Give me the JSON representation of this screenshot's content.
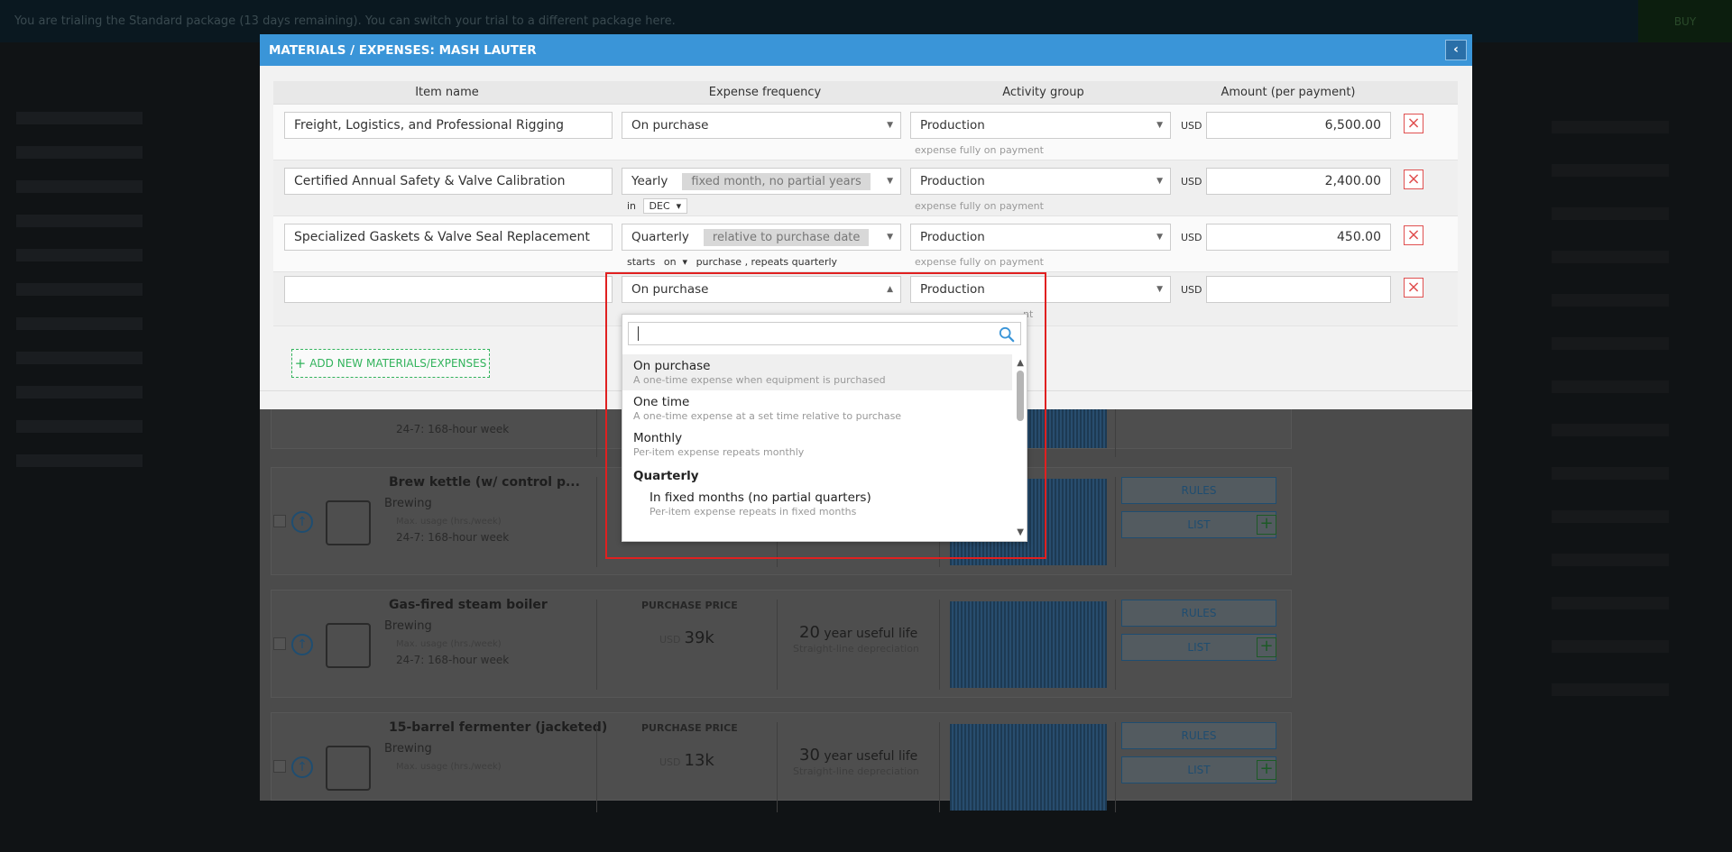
{
  "banner": {
    "text": "You are trialing the Standard package (13 days remaining). You can switch your trial to a different package here.",
    "buy_label": "BUY"
  },
  "modal": {
    "title": "MATERIALS / EXPENSES: MASH LAUTER",
    "collapse_icon": "chevron-left-icon",
    "columns": {
      "item_name": "Item name",
      "frequency": "Expense frequency",
      "activity": "Activity group",
      "amount": "Amount (per payment)"
    },
    "rows": [
      {
        "name": "Freight, Logistics, and Professional Rigging",
        "frequency": "On purchase",
        "frequency_tag": "",
        "activity": "Production",
        "activity_sub": "expense fully on payment",
        "currency": "USD",
        "amount": "6,500.00"
      },
      {
        "name": "Certified Annual Safety & Valve Calibration",
        "frequency": "Yearly",
        "frequency_tag": "fixed month, no partial years",
        "sub_prefix": "in",
        "sub_month": "DEC",
        "activity": "Production",
        "activity_sub": "expense fully on payment",
        "currency": "USD",
        "amount": "2,400.00"
      },
      {
        "name": "Specialized Gaskets & Valve Seal Replacement",
        "frequency": "Quarterly",
        "frequency_tag": "relative to purchase date",
        "sub_starts": "starts",
        "sub_on": "on",
        "sub_rest": "purchase , repeats quarterly",
        "activity": "Production",
        "activity_sub": "expense fully on payment",
        "currency": "USD",
        "amount": "450.00"
      },
      {
        "name": "",
        "frequency": "On purchase",
        "activity": "Production",
        "activity_sub": "nt",
        "currency": "USD",
        "amount": ""
      }
    ],
    "add_button": "ADD NEW MATERIALS/EXPENSES"
  },
  "dropdown": {
    "search_value": "",
    "options": [
      {
        "title": "On purchase",
        "desc": "A one-time expense when equipment is purchased"
      },
      {
        "title": "One time",
        "desc": "A one-time expense at a set time relative to purchase"
      },
      {
        "title": "Monthly",
        "desc": "Per-item expense repeats monthly"
      }
    ],
    "group_quarterly": "Quarterly",
    "quarterly_first": {
      "title": "In fixed months (no partial quarters)",
      "desc": "Per-item expense repeats in fixed months"
    }
  },
  "background": {
    "cards": [
      {
        "name": "",
        "category": "",
        "usage_label": "",
        "usage": "24-7: 168-hour week",
        "purchase_label": "",
        "price": "",
        "life_num": "",
        "life_text": "",
        "dep": "",
        "rules": "",
        "list": ""
      },
      {
        "name": "Brew kettle (w/ control p...",
        "category": "Brewing",
        "usage_label": "Max. usage (hrs./week)",
        "usage": "24-7: 168-hour week",
        "purchase_label": "",
        "price": "",
        "life_num": "",
        "life_text": "",
        "dep": "",
        "rules": "RULES",
        "list": "LIST"
      },
      {
        "name": "Gas-fired steam boiler",
        "category": "Brewing",
        "usage_label": "Max. usage (hrs./week)",
        "usage": "24-7: 168-hour week",
        "purchase_label": "PURCHASE PRICE",
        "currency": "USD",
        "price": "39k",
        "life_num": "20",
        "life_text": "year useful life",
        "dep": "Straight-line depreciation",
        "rules": "RULES",
        "list": "LIST"
      },
      {
        "name": "15-barrel fermenter (jacketed)",
        "category": "Brewing",
        "usage_label": "Max. usage (hrs./week)",
        "usage": "",
        "purchase_label": "PURCHASE PRICE",
        "currency": "USD",
        "price": "13k",
        "life_num": "30",
        "life_text": "year useful life",
        "dep": "Straight-line depreciation",
        "rules": "RULES",
        "list": "LIST"
      }
    ]
  }
}
